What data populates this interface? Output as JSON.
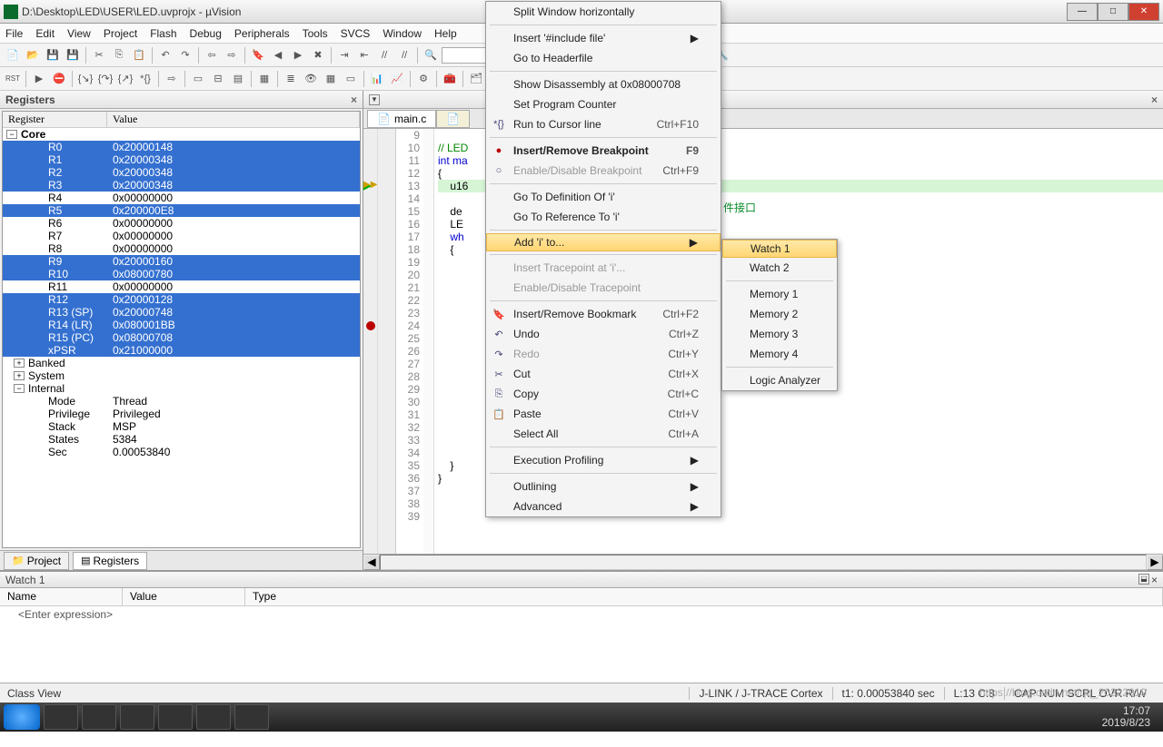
{
  "window": {
    "title": "D:\\Desktop\\LED\\USER\\LED.uvprojx - µVision"
  },
  "menubar": [
    "File",
    "Edit",
    "View",
    "Project",
    "Flash",
    "Debug",
    "Peripherals",
    "Tools",
    "SVCS",
    "Window",
    "Help"
  ],
  "panels": {
    "registers_title": "Registers",
    "reg_head_register": "Register",
    "reg_head_value": "Value",
    "reg_core": "Core",
    "reg_groups": {
      "banked": "Banked",
      "system": "System",
      "internal": "Internal"
    },
    "regs": [
      {
        "n": "R0",
        "v": "0x20000148",
        "s": true
      },
      {
        "n": "R1",
        "v": "0x20000348",
        "s": true
      },
      {
        "n": "R2",
        "v": "0x20000348",
        "s": true
      },
      {
        "n": "R3",
        "v": "0x20000348",
        "s": true
      },
      {
        "n": "R4",
        "v": "0x00000000",
        "s": false
      },
      {
        "n": "R5",
        "v": "0x200000E8",
        "s": true
      },
      {
        "n": "R6",
        "v": "0x00000000",
        "s": false
      },
      {
        "n": "R7",
        "v": "0x00000000",
        "s": false
      },
      {
        "n": "R8",
        "v": "0x00000000",
        "s": false
      },
      {
        "n": "R9",
        "v": "0x20000160",
        "s": true
      },
      {
        "n": "R10",
        "v": "0x08000780",
        "s": true
      },
      {
        "n": "R11",
        "v": "0x00000000",
        "s": false
      },
      {
        "n": "R12",
        "v": "0x20000128",
        "s": true
      },
      {
        "n": "R13 (SP)",
        "v": "0x20000748",
        "s": true
      },
      {
        "n": "R14 (LR)",
        "v": "0x080001BB",
        "s": true
      },
      {
        "n": "R15 (PC)",
        "v": "0x08000708",
        "s": true
      },
      {
        "n": "xPSR",
        "v": "0x21000000",
        "s": true
      }
    ],
    "internal_rows": [
      {
        "n": "Mode",
        "v": "Thread"
      },
      {
        "n": "Privilege",
        "v": "Privileged"
      },
      {
        "n": "Stack",
        "v": "MSP"
      },
      {
        "n": "States",
        "v": "5384"
      },
      {
        "n": "Sec",
        "v": "0.00053840"
      }
    ],
    "project_tab": "Project",
    "registers_tab": "Registers"
  },
  "editor": {
    "file_tab": "main.c",
    "lines": [
      {
        "ln": 9,
        "txt": ""
      },
      {
        "ln": 10,
        "txt": "// LED",
        "cls": "cmt"
      },
      {
        "ln": 11,
        "txt": "int ma",
        "kw": true
      },
      {
        "ln": 12,
        "txt": "{"
      },
      {
        "ln": 13,
        "txt": "    u16 ",
        "hl": true,
        "cur": true
      },
      {
        "ln": 14,
        "txt": ""
      },
      {
        "ln": 15,
        "txt": "    de"
      },
      {
        "ln": 16,
        "txt": "    LE",
        "cn": "件接口"
      },
      {
        "ln": 17,
        "txt": "    wh",
        "kw": true
      },
      {
        "ln": 18,
        "txt": "    {"
      },
      {
        "ln": 19,
        "txt": ""
      },
      {
        "ln": 20,
        "txt": ""
      },
      {
        "ln": 21,
        "txt": ""
      },
      {
        "ln": 22,
        "txt": ""
      },
      {
        "ln": 23,
        "txt": ""
      },
      {
        "ln": 24,
        "txt": "",
        "bp": true
      },
      {
        "ln": 25,
        "txt": ""
      },
      {
        "ln": 26,
        "txt": ""
      },
      {
        "ln": 27,
        "txt": ""
      },
      {
        "ln": 28,
        "txt": ""
      },
      {
        "ln": 29,
        "txt": ""
      },
      {
        "ln": 30,
        "txt": ""
      },
      {
        "ln": 31,
        "txt": ""
      },
      {
        "ln": 32,
        "txt": ""
      },
      {
        "ln": 33,
        "txt": ""
      },
      {
        "ln": 34,
        "txt": ""
      },
      {
        "ln": 35,
        "txt": "    }"
      },
      {
        "ln": 36,
        "txt": "}"
      },
      {
        "ln": 37,
        "txt": ""
      },
      {
        "ln": 38,
        "txt": ""
      },
      {
        "ln": 39,
        "txt": ""
      }
    ]
  },
  "watch": {
    "title": "Watch 1",
    "col_name": "Name",
    "col_value": "Value",
    "col_type": "Type",
    "placeholder": "<Enter expression>"
  },
  "status": {
    "classview": "Class View",
    "debugger": "J-LINK / J-TRACE Cortex",
    "time": "t1: 0.00053840 sec",
    "pos": "L:13 C:8",
    "caps": "CAP  NUM  SCRL  OVR  R/W",
    "watermark": "https://blog.csdn.net/qq_20222919",
    "clock_time": "17:07",
    "clock_date": "2019/8/23"
  },
  "ctx_main": [
    {
      "t": "Split Window horizontally"
    },
    {
      "sep": true
    },
    {
      "t": "Insert '#include file'",
      "arrow": true
    },
    {
      "t": "Go to Headerfile"
    },
    {
      "sep": true
    },
    {
      "t": "Show Disassembly at 0x08000708"
    },
    {
      "t": "Set Program Counter"
    },
    {
      "t": "Run to Cursor line",
      "sc": "Ctrl+F10",
      "ico": "*{}"
    },
    {
      "sep": true
    },
    {
      "t": "Insert/Remove Breakpoint",
      "sc": "F9",
      "ico": "●",
      "bold": true,
      "icolor": "#b00"
    },
    {
      "t": "Enable/Disable Breakpoint",
      "sc": "Ctrl+F9",
      "ico": "○",
      "dis": true
    },
    {
      "sep": true
    },
    {
      "t": "Go To Definition Of 'i'"
    },
    {
      "t": "Go To Reference To 'i'"
    },
    {
      "sep": true
    },
    {
      "t": "Add 'i' to...",
      "arrow": true,
      "hl": true
    },
    {
      "sep": true
    },
    {
      "t": "Insert Tracepoint at 'i'...",
      "dis": true
    },
    {
      "t": "Enable/Disable Tracepoint",
      "dis": true
    },
    {
      "sep": true
    },
    {
      "t": "Insert/Remove Bookmark",
      "sc": "Ctrl+F2",
      "ico": "🔖"
    },
    {
      "t": "Undo",
      "sc": "Ctrl+Z",
      "ico": "↶"
    },
    {
      "t": "Redo",
      "sc": "Ctrl+Y",
      "ico": "↷",
      "dis": true
    },
    {
      "t": "Cut",
      "sc": "Ctrl+X",
      "ico": "✂"
    },
    {
      "t": "Copy",
      "sc": "Ctrl+C",
      "ico": "⎘"
    },
    {
      "t": "Paste",
      "sc": "Ctrl+V",
      "ico": "📋"
    },
    {
      "t": "Select All",
      "sc": "Ctrl+A"
    },
    {
      "sep": true
    },
    {
      "t": "Execution Profiling",
      "arrow": true
    },
    {
      "sep": true
    },
    {
      "t": "Outlining",
      "arrow": true
    },
    {
      "t": "Advanced",
      "arrow": true
    }
  ],
  "ctx_sub": [
    {
      "t": "Watch 1",
      "hl": true
    },
    {
      "t": "Watch 2"
    },
    {
      "sep": true
    },
    {
      "t": "Memory 1"
    },
    {
      "t": "Memory 2"
    },
    {
      "t": "Memory 3"
    },
    {
      "t": "Memory 4"
    },
    {
      "sep": true
    },
    {
      "t": "Logic Analyzer"
    }
  ]
}
